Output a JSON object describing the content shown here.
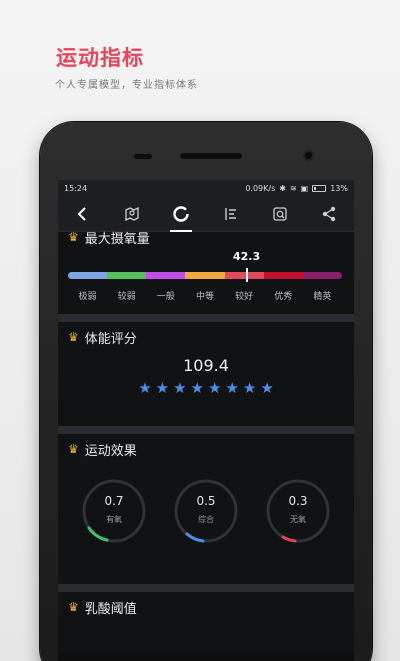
{
  "promo": {
    "title": "运动指标",
    "subtitle": "个人专属模型，专业指标体系"
  },
  "status_bar": {
    "time": "15:24",
    "speed": "0.09K/s",
    "battery": "13%"
  },
  "nav": {
    "items": [
      {
        "icon": "back-icon"
      },
      {
        "icon": "map-icon"
      },
      {
        "icon": "ring-icon",
        "active": true
      },
      {
        "icon": "list-icon"
      },
      {
        "icon": "search-doc-icon"
      },
      {
        "icon": "share-icon"
      }
    ]
  },
  "vo2max": {
    "title": "最大摄氧量",
    "value": "42.3",
    "levels": [
      "极弱",
      "较弱",
      "一般",
      "中等",
      "较好",
      "优秀",
      "精英"
    ],
    "colors": [
      "#7ea6e0",
      "#57c05a",
      "#c34ee8",
      "#f3a840",
      "#e04a5a",
      "#c0102e",
      "#8a1f6e"
    ]
  },
  "fitness": {
    "title": "体能评分",
    "value": "109.4",
    "stars": 8
  },
  "effect": {
    "title": "运动效果",
    "rings": [
      {
        "value": "0.7",
        "label": "有氧",
        "color": "#3cc86a"
      },
      {
        "value": "0.5",
        "label": "综合",
        "color": "#4a8fe7"
      },
      {
        "value": "0.3",
        "label": "无氧",
        "color": "#e64358"
      }
    ]
  },
  "lactate": {
    "title": "乳酸阈值"
  },
  "colors": {
    "accent": "#e8455b",
    "star": "#4a8fe7",
    "crown": "#f0b030"
  }
}
